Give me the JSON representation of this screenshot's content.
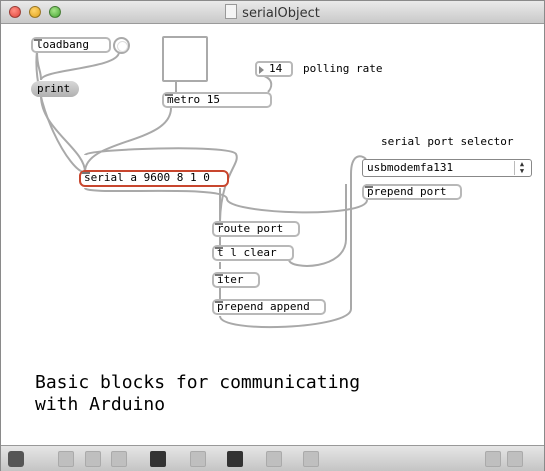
{
  "window": {
    "title": "serialObject"
  },
  "patcher": {
    "objects": {
      "loadbang": "loadbang",
      "print": "print",
      "metro": "metro 15",
      "polling_value": "14",
      "polling_label": "polling rate",
      "serial": "serial a 9600 8 1 0",
      "port_label": "serial port selector",
      "port_menu": "usbmodemfa131",
      "prepend_port": "prepend port",
      "route_port": "route port",
      "t_clear": "t l clear",
      "iter": "iter",
      "prepend_append": "prepend append"
    },
    "comment_line1": "Basic blocks for communicating",
    "comment_line2": "with Arduino"
  },
  "colors": {
    "selected_border": "#c8462e",
    "cord": "#a9a9a9"
  },
  "toolbar": {
    "icons": [
      "lock-icon",
      "new-object-icon",
      "delete-icon",
      "presentation-icon",
      "info-icon",
      "inspector-icon",
      "clue-icon",
      "zoom-icon",
      "grid-icon",
      "present-icon"
    ]
  }
}
